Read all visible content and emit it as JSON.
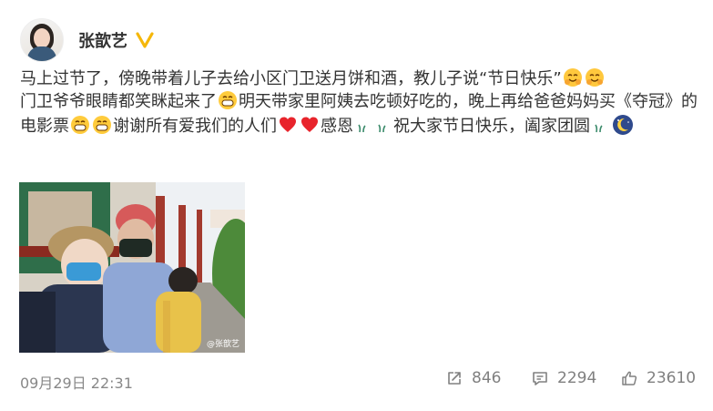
{
  "user": {
    "name": "张歆艺",
    "avatar_icon": "avatar",
    "verified_icon": "verified-badge-icon",
    "verified_color": "#f5b70a"
  },
  "post": {
    "segments": [
      "马上过节了，傍晚带着儿子去给小区门卫送月饼和酒，教儿子说“节日快乐”",
      "门卫爷爷眼睛都笑眯起来了",
      "明天带家里阿姨去吃顿好吃的，晚上再给爸爸妈妈买《夺冠》的电影票",
      "谢谢所有爱我们的人们",
      "感恩",
      "祝大家节日快乐，阖家团圆"
    ],
    "emojis": {
      "hug": "hug-emoji-icon",
      "grin": "grin-emoji-icon",
      "heart": "heart-emoji-icon",
      "grass": "grass-emoji-icon",
      "moon": "moon-emoji-icon"
    },
    "image": {
      "description_icon": "family-photo",
      "watermark": "@张歆艺"
    }
  },
  "footer": {
    "timestamp": "09月29日 22:31",
    "forward_count": "846",
    "comment_count": "2294",
    "like_count": "23610",
    "forward_icon": "share-icon",
    "comment_icon": "comment-icon",
    "like_icon": "thumbs-up-icon"
  }
}
